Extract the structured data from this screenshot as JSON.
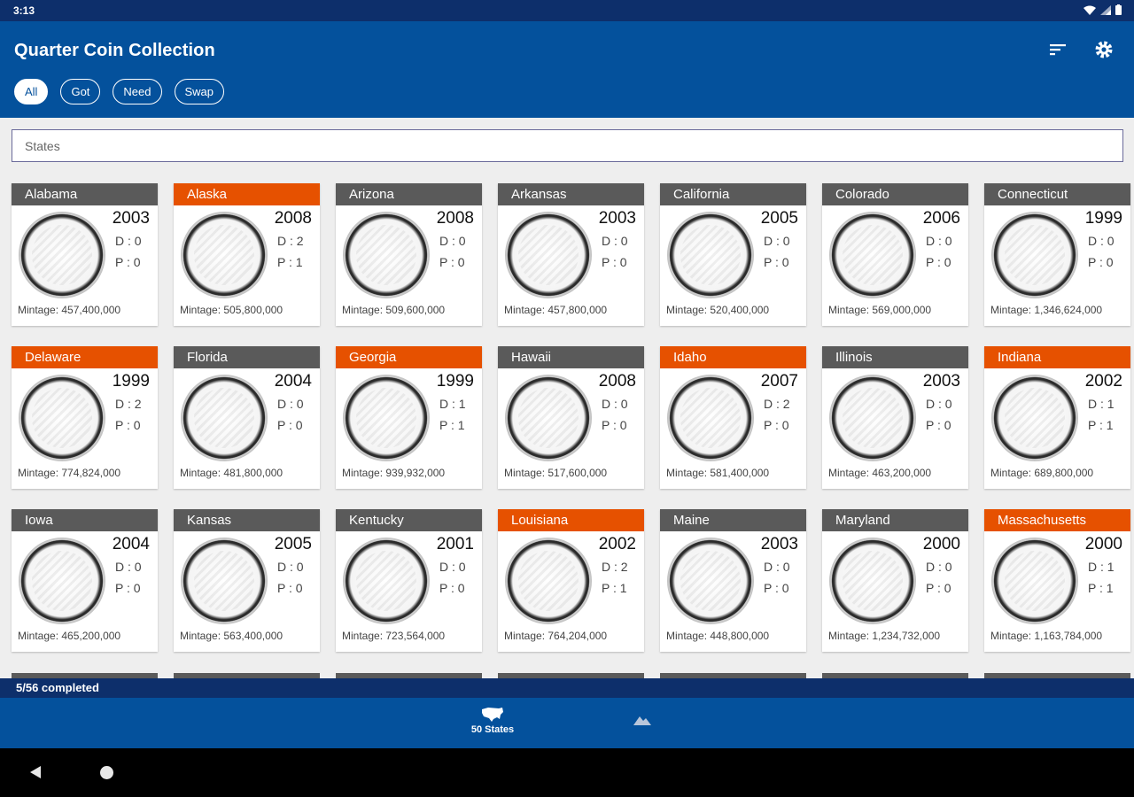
{
  "status_bar": {
    "time": "3:13"
  },
  "app": {
    "title": "Quarter Coin Collection"
  },
  "filters": [
    {
      "label": "All",
      "active": true
    },
    {
      "label": "Got",
      "active": false
    },
    {
      "label": "Need",
      "active": false
    },
    {
      "label": "Swap",
      "active": false
    }
  ],
  "search": {
    "placeholder": "States"
  },
  "mintage_prefix": "Mintage: ",
  "d_prefix": "D : ",
  "p_prefix": "P : ",
  "coins": [
    {
      "state": "Alabama",
      "year": "2003",
      "d": "0",
      "p": "0",
      "mintage": "457,400,000",
      "need": false
    },
    {
      "state": "Alaska",
      "year": "2008",
      "d": "2",
      "p": "1",
      "mintage": "505,800,000",
      "need": true
    },
    {
      "state": "Arizona",
      "year": "2008",
      "d": "0",
      "p": "0",
      "mintage": "509,600,000",
      "need": false
    },
    {
      "state": "Arkansas",
      "year": "2003",
      "d": "0",
      "p": "0",
      "mintage": "457,800,000",
      "need": false
    },
    {
      "state": "California",
      "year": "2005",
      "d": "0",
      "p": "0",
      "mintage": "520,400,000",
      "need": false
    },
    {
      "state": "Colorado",
      "year": "2006",
      "d": "0",
      "p": "0",
      "mintage": "569,000,000",
      "need": false
    },
    {
      "state": "Connecticut",
      "year": "1999",
      "d": "0",
      "p": "0",
      "mintage": "1,346,624,000",
      "need": false
    },
    {
      "state": "Delaware",
      "year": "1999",
      "d": "2",
      "p": "0",
      "mintage": "774,824,000",
      "need": true
    },
    {
      "state": "Florida",
      "year": "2004",
      "d": "0",
      "p": "0",
      "mintage": "481,800,000",
      "need": false
    },
    {
      "state": "Georgia",
      "year": "1999",
      "d": "1",
      "p": "1",
      "mintage": "939,932,000",
      "need": true
    },
    {
      "state": "Hawaii",
      "year": "2008",
      "d": "0",
      "p": "0",
      "mintage": "517,600,000",
      "need": false
    },
    {
      "state": "Idaho",
      "year": "2007",
      "d": "2",
      "p": "0",
      "mintage": "581,400,000",
      "need": true
    },
    {
      "state": "Illinois",
      "year": "2003",
      "d": "0",
      "p": "0",
      "mintage": "463,200,000",
      "need": false
    },
    {
      "state": "Indiana",
      "year": "2002",
      "d": "1",
      "p": "1",
      "mintage": "689,800,000",
      "need": true
    },
    {
      "state": "Iowa",
      "year": "2004",
      "d": "0",
      "p": "0",
      "mintage": "465,200,000",
      "need": false
    },
    {
      "state": "Kansas",
      "year": "2005",
      "d": "0",
      "p": "0",
      "mintage": "563,400,000",
      "need": false
    },
    {
      "state": "Kentucky",
      "year": "2001",
      "d": "0",
      "p": "0",
      "mintage": "723,564,000",
      "need": false
    },
    {
      "state": "Louisiana",
      "year": "2002",
      "d": "2",
      "p": "1",
      "mintage": "764,204,000",
      "need": true
    },
    {
      "state": "Maine",
      "year": "2003",
      "d": "0",
      "p": "0",
      "mintage": "448,800,000",
      "need": false
    },
    {
      "state": "Maryland",
      "year": "2000",
      "d": "0",
      "p": "0",
      "mintage": "1,234,732,000",
      "need": false
    },
    {
      "state": "Massachusetts",
      "year": "2000",
      "d": "1",
      "p": "1",
      "mintage": "1,163,784,000",
      "need": true
    }
  ],
  "progress": {
    "text": "5/56 completed"
  },
  "bottom_nav": [
    {
      "label": "50 States",
      "icon": "usa-map-icon"
    },
    {
      "label": "",
      "icon": "mountains-icon"
    }
  ],
  "colors": {
    "primary": "#04519c",
    "dark": "#0d2f6b",
    "need": "#e65100",
    "header": "#5a5a5a"
  }
}
